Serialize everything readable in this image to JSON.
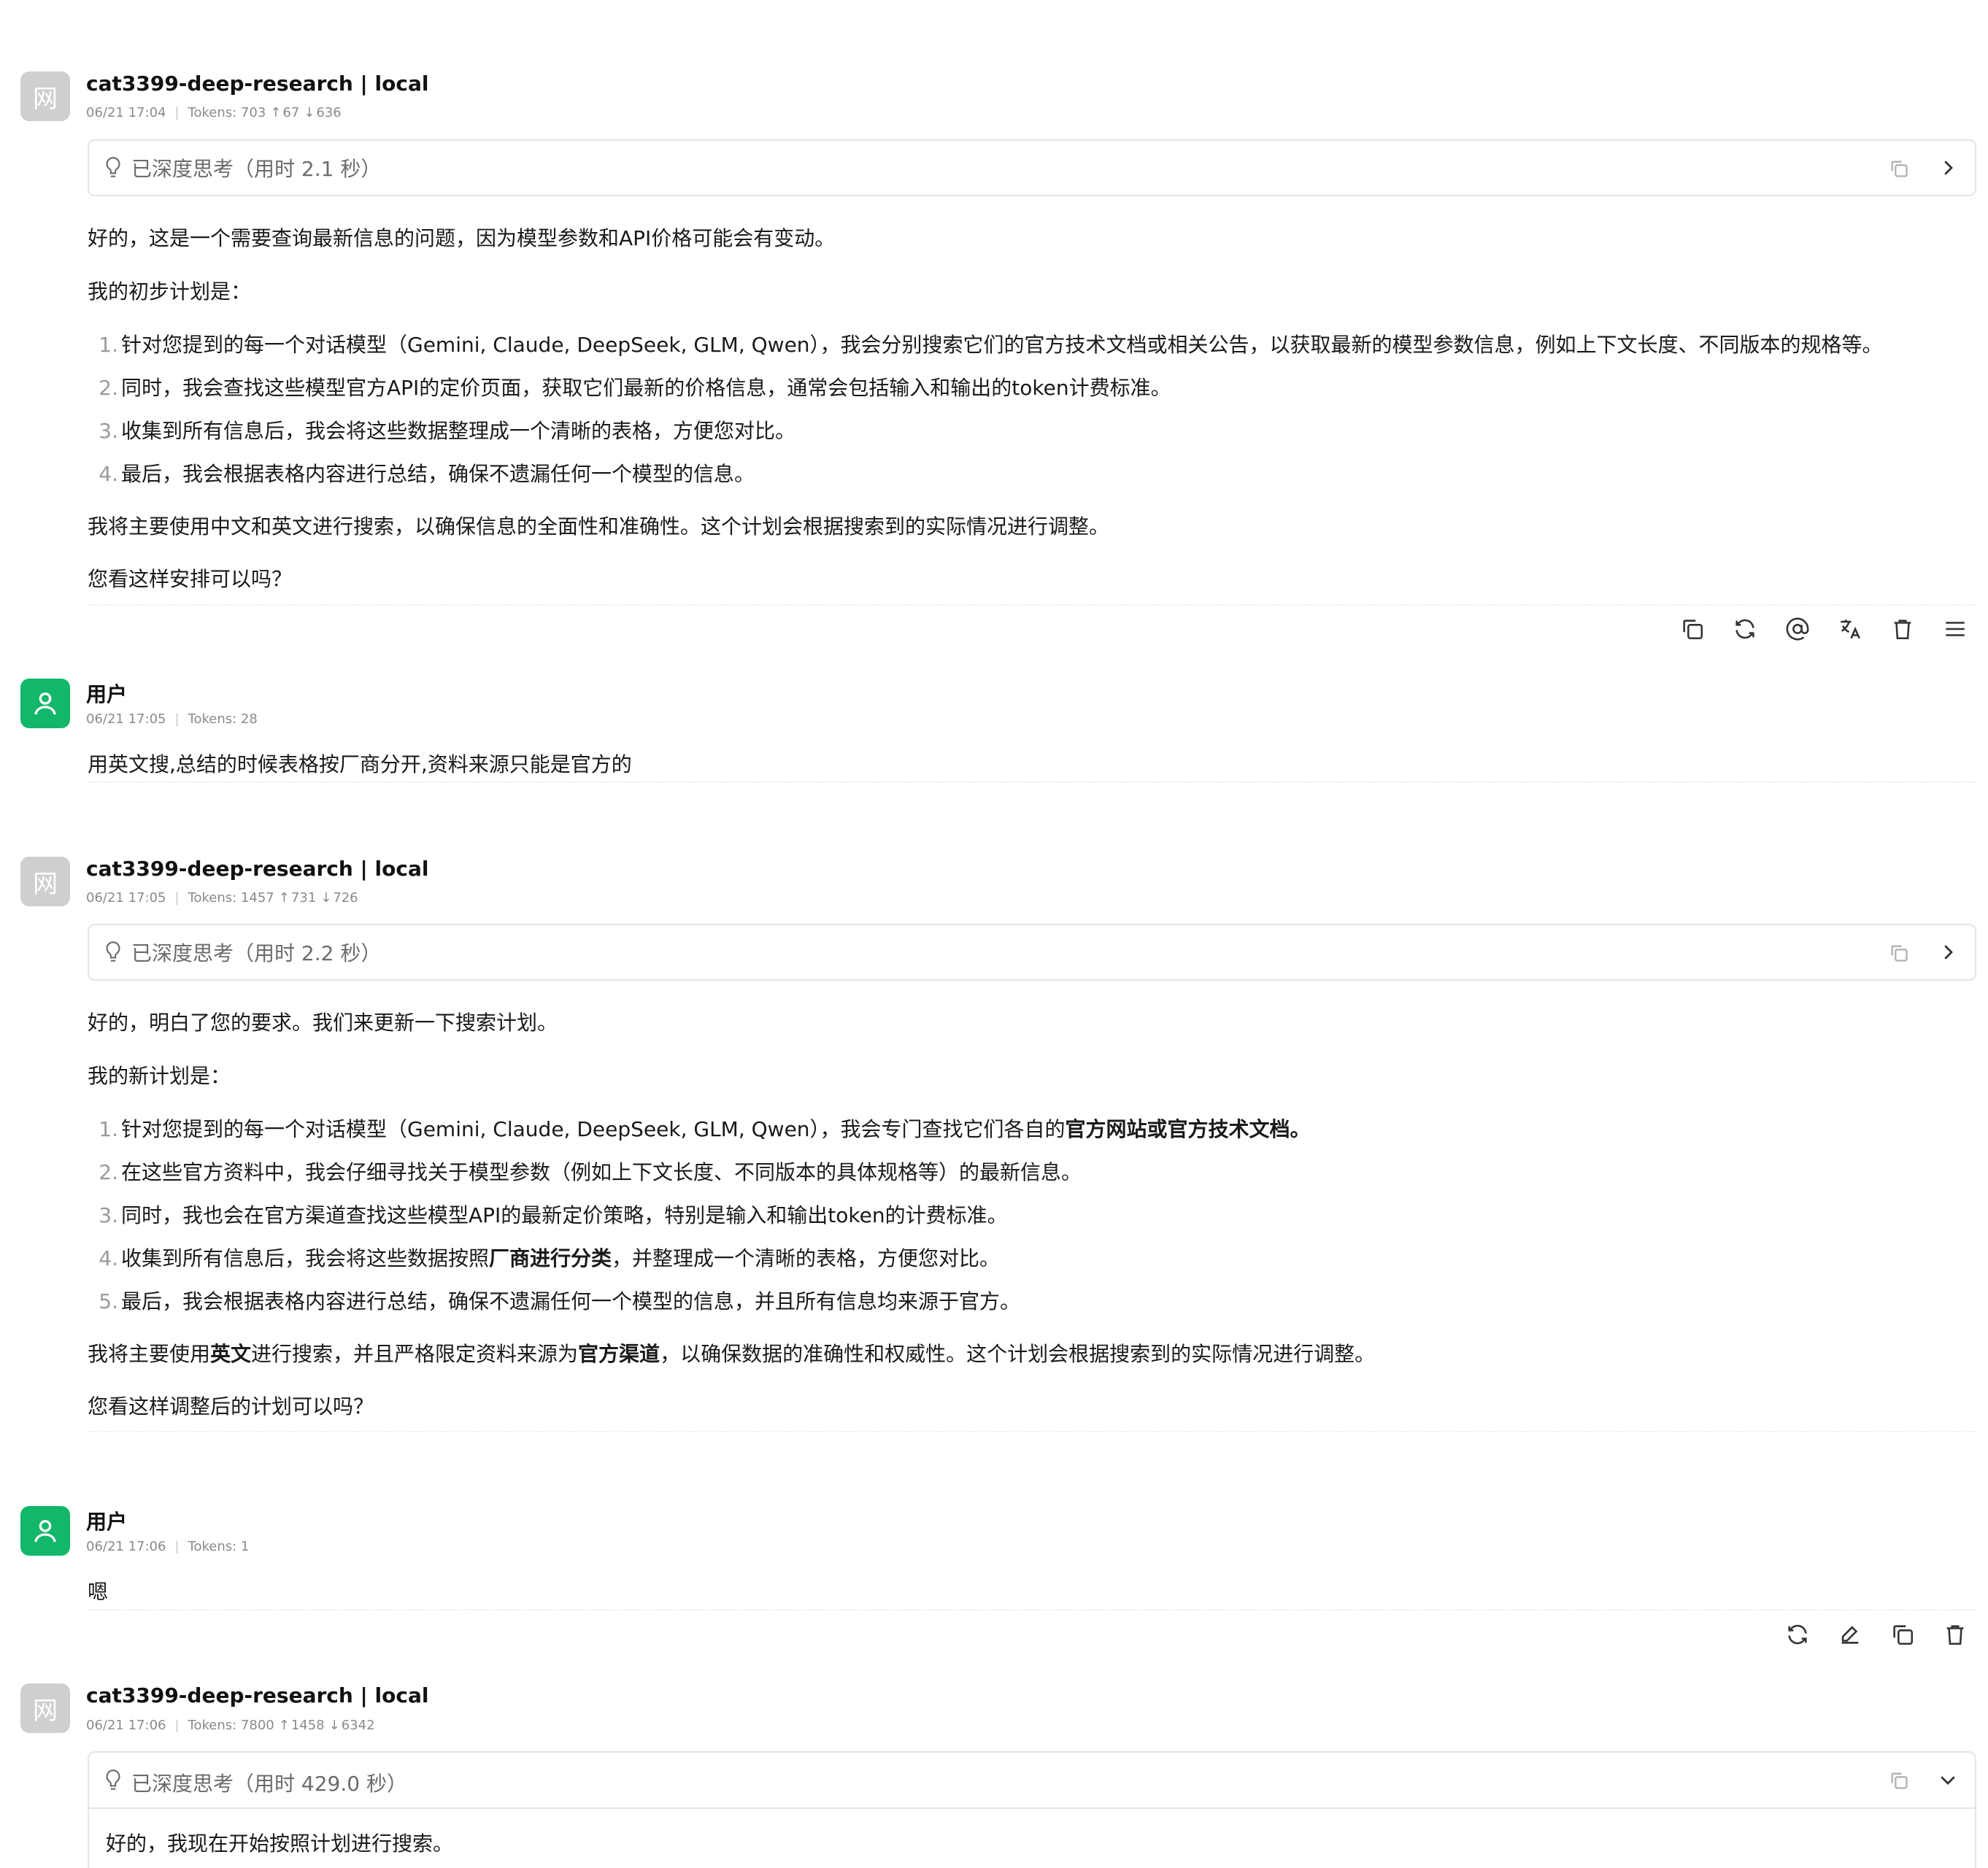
{
  "messages": [
    {
      "role": "bot",
      "avatar_text": "网",
      "name": "cat3399-deep-research | local",
      "time": "06/21 17:04",
      "tokens": "Tokens: 703",
      "tokens_up": "67",
      "tokens_down": "636",
      "think_label": "已深度思考（用时 2.1 秒）",
      "intro": "好的，这是一个需要查询最新信息的问题，因为模型参数和API价格可能会有变动。",
      "plan_title": "我的初步计划是：",
      "items": [
        {
          "num": "1.",
          "text": "针对您提到的每一个对话模型（Gemini, Claude, DeepSeek, GLM, Qwen），我会分别搜索它们的官方技术文档或相关公告，以获取最新的模型参数信息，例如上下文长度、不同版本的规格等。"
        },
        {
          "num": "2.",
          "text": "同时，我会查找这些模型官方API的定价页面，获取它们最新的价格信息，通常会包括输入和输出的token计费标准。"
        },
        {
          "num": "3.",
          "text": "收集到所有信息后，我会将这些数据整理成一个清晰的表格，方便您对比。"
        },
        {
          "num": "4.",
          "text": "最后，我会根据表格内容进行总结，确保不遗漏任何一个模型的信息。"
        }
      ],
      "closing": "我将主要使用中文和英文进行搜索，以确保信息的全面性和准确性。这个计划会根据搜索到的实际情况进行调整。",
      "question": "您看这样安排可以吗？"
    },
    {
      "role": "user",
      "name": "用户",
      "time": "06/21 17:05",
      "tokens": "Tokens: 28",
      "text": "用英文搜,总结的时候表格按厂商分开,资料来源只能是官方的"
    },
    {
      "role": "bot",
      "avatar_text": "网",
      "name": "cat3399-deep-research | local",
      "time": "06/21 17:05",
      "tokens": "Tokens: 1457",
      "tokens_up": "731",
      "tokens_down": "726",
      "think_label": "已深度思考（用时 2.2 秒）",
      "intro": "好的，明白了您的要求。我们来更新一下搜索计划。",
      "plan_title": "我的新计划是：",
      "items": [
        {
          "num": "1.",
          "pre": "针对您提到的每一个对话模型（Gemini, Claude, DeepSeek, GLM, Qwen），我会专门查找它们各自的",
          "bold": "官方网站或官方技术文档。",
          "post": ""
        },
        {
          "num": "2.",
          "pre": "在这些官方资料中，我会仔细寻找关于模型参数（例如上下文长度、不同版本的具体规格等）的最新信息。",
          "bold": "",
          "post": ""
        },
        {
          "num": "3.",
          "pre": "同时，我也会在官方渠道查找这些模型API的最新定价策略，特别是输入和输出token的计费标准。",
          "bold": "",
          "post": ""
        },
        {
          "num": "4.",
          "pre": "收集到所有信息后，我会将这些数据按照",
          "bold": "厂商进行分类",
          "post": "，并整理成一个清晰的表格，方便您对比。"
        },
        {
          "num": "5.",
          "pre": "最后，我会根据表格内容进行总结，确保不遗漏任何一个模型的信息，并且所有信息均来源于官方。",
          "bold": "",
          "post": ""
        }
      ],
      "closing_pre": "我将主要使用",
      "closing_b1": "英文",
      "closing_mid": "进行搜索，并且严格限定资料来源为",
      "closing_b2": "官方渠道",
      "closing_post": "，以确保数据的准确性和权威性。这个计划会根据搜索到的实际情况进行调整。",
      "question": "您看这样调整后的计划可以吗？"
    },
    {
      "role": "user",
      "name": "用户",
      "time": "06/21 17:06",
      "tokens": "Tokens: 1",
      "text": "嗯"
    },
    {
      "role": "bot",
      "avatar_text": "网",
      "name": "cat3399-deep-research | local",
      "time": "06/21 17:06",
      "tokens": "Tokens: 7800",
      "tokens_up": "1458",
      "tokens_down": "6342",
      "think_label": "已深度思考（用时 429.0 秒）",
      "think_body": "好的，我现在开始按照计划进行搜索。"
    }
  ],
  "icons": {
    "bot_actions": [
      "copy-icon",
      "regenerate-icon",
      "mention-icon",
      "translate-icon",
      "delete-icon",
      "menu-icon"
    ],
    "user_actions": [
      "regenerate-icon",
      "edit-icon",
      "copy-icon",
      "delete-icon"
    ]
  },
  "colors": {
    "user_avatar": "#12b76a",
    "bot_avatar": "#cfcfcf",
    "meta_text": "#8a8a8a",
    "think_border": "#e4e4e4"
  }
}
